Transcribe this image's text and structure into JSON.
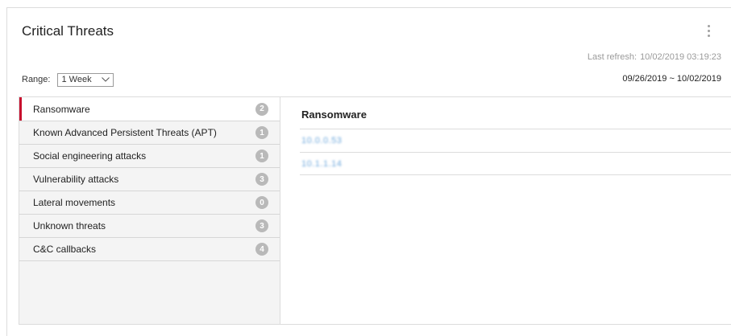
{
  "widget": {
    "title": "Critical Threats",
    "last_refresh_label": "Last refresh:",
    "last_refresh_value": "10/02/2019 03:19:23",
    "range_label": "Range:",
    "range_value": "1 Week",
    "date_range": "09/26/2019  ~  10/02/2019"
  },
  "categories": [
    {
      "label": "Ransomware",
      "count": "2"
    },
    {
      "label": "Known Advanced Persistent Threats (APT)",
      "count": "1"
    },
    {
      "label": "Social engineering attacks",
      "count": "1"
    },
    {
      "label": "Vulnerability attacks",
      "count": "3"
    },
    {
      "label": "Lateral movements",
      "count": "0"
    },
    {
      "label": "Unknown threats",
      "count": "3"
    },
    {
      "label": "C&C callbacks",
      "count": "4"
    }
  ],
  "detail": {
    "title": "Ransomware",
    "hosts": [
      "10.0.0.53",
      "10.1.1.14"
    ]
  },
  "colors": {
    "accent": "#c8102e",
    "badge": "#b9b9b9",
    "link": "#6ea8dc"
  },
  "icons": {
    "menu": "kebab-menu-icon",
    "dropdown": "chevron-down-icon"
  }
}
